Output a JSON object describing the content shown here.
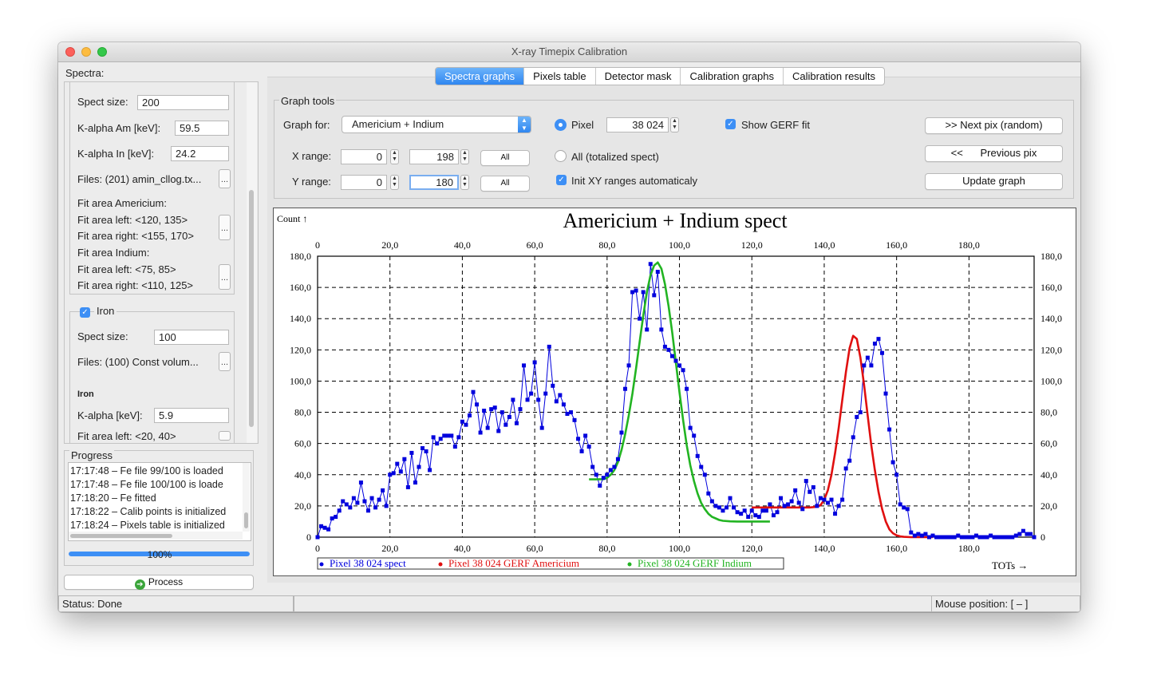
{
  "window": {
    "title": "X-ray Timepix Calibration"
  },
  "tabs": [
    "Spectra graphs",
    "Pixels table",
    "Detector mask",
    "Calibration graphs",
    "Calibration results"
  ],
  "left": {
    "spectra_label": "Spectra:",
    "am_in": {
      "spect_size_label": "Spect size:",
      "spect_size": "200",
      "k_alpha_am_label": "K-alpha Am [keV]:",
      "k_alpha_am": "59.5",
      "k_alpha_in_label": "K-alpha In [keV]:",
      "k_alpha_in": "24.2",
      "files_label": "Files: (201) amin_cllog.tx...",
      "fit_am_title": "Fit area Americium:",
      "fit_am_left": "Fit area left: <120, 135>",
      "fit_am_right": "Fit area right: <155, 170>",
      "fit_in_title": "Fit area Indium:",
      "fit_in_left": "Fit area left: <75, 85>",
      "fit_in_right": "Fit area right: <110, 125>",
      "dots": "..."
    },
    "iron": {
      "title": "Iron",
      "spect_size_label": "Spect size:",
      "spect_size": "100",
      "files_label": "Files: (100) Const volum...",
      "sub_title": "Iron",
      "k_alpha_label": "K-alpha [keV]:",
      "k_alpha": "5.9",
      "fit_left": "Fit area left: <20, 40>",
      "dots": "..."
    },
    "progress": {
      "title": "Progress",
      "log": [
        "17:17:48 – Fe file 99/100 is loaded",
        "17:17:48 – Fe file 100/100 is loade",
        "17:18:20 – Fe fitted",
        "17:18:22 – Calib points is initialized",
        "17:18:24 – Pixels table is initialized"
      ],
      "percent": "100%",
      "value": 1.0
    },
    "process_label": "Process"
  },
  "graph_tools": {
    "title": "Graph tools",
    "graph_for_label": "Graph for:",
    "graph_for_value": "Americium + Indium",
    "pixel_label": "Pixel",
    "pixel_value": "38 024",
    "show_gerf_label": "Show GERF fit",
    "x_range_label": "X range:",
    "x_min": "0",
    "x_max": "198",
    "y_range_label": "Y range:",
    "y_min": "0",
    "y_max": "180",
    "all_label": "All",
    "all_totalized_label": "All (totalized spect)",
    "init_xy_label": "Init XY ranges automaticaly",
    "next_pix_label": ">> Next pix (random)",
    "prev_pix_label": "<<      Previous pix",
    "update_label": "Update graph"
  },
  "status": {
    "left": "Status: Done",
    "right": "Mouse position: [ – ]"
  },
  "chart_data": {
    "type": "scatter",
    "title": "Americium + Indium spect",
    "ylabel": "Count ↑",
    "xlabel": "TOTs →",
    "xlim": [
      0,
      198
    ],
    "ylim": [
      0,
      180
    ],
    "x_ticks": [
      0,
      20,
      40,
      60,
      80,
      100,
      120,
      140,
      160,
      180
    ],
    "x_tick_labels": [
      "0",
      "20,0",
      "40,0",
      "60,0",
      "80,0",
      "100,0",
      "120,0",
      "140,0",
      "160,0",
      "180,0"
    ],
    "y_ticks": [
      0,
      20,
      40,
      60,
      80,
      100,
      120,
      140,
      160,
      180
    ],
    "y_tick_labels": [
      "0",
      "20,0",
      "40,0",
      "60,0",
      "80,0",
      "100,0",
      "120,0",
      "140,0",
      "160,0",
      "180,0"
    ],
    "grid": true,
    "legend_position": "bottom-left",
    "colors": {
      "spect": "#0000dd",
      "americium": "#e01010",
      "indium": "#22b422"
    },
    "series": [
      {
        "name": "Pixel 38 024 spect",
        "x": [
          0,
          1,
          2,
          3,
          4,
          5,
          6,
          7,
          8,
          9,
          10,
          11,
          12,
          13,
          14,
          15,
          16,
          17,
          18,
          19,
          20,
          21,
          22,
          23,
          24,
          25,
          26,
          27,
          28,
          29,
          30,
          31,
          32,
          33,
          34,
          35,
          36,
          37,
          38,
          39,
          40,
          41,
          42,
          43,
          44,
          45,
          46,
          47,
          48,
          49,
          50,
          51,
          52,
          53,
          54,
          55,
          56,
          57,
          58,
          59,
          60,
          61,
          62,
          63,
          64,
          65,
          66,
          67,
          68,
          69,
          70,
          71,
          72,
          73,
          74,
          75,
          76,
          77,
          78,
          79,
          80,
          81,
          82,
          83,
          84,
          85,
          86,
          87,
          88,
          89,
          90,
          91,
          92,
          93,
          94,
          95,
          96,
          97,
          98,
          99,
          100,
          101,
          102,
          103,
          104,
          105,
          106,
          107,
          108,
          109,
          110,
          111,
          112,
          113,
          114,
          115,
          116,
          117,
          118,
          119,
          120,
          121,
          122,
          123,
          124,
          125,
          126,
          127,
          128,
          129,
          130,
          131,
          132,
          133,
          134,
          135,
          136,
          137,
          138,
          139,
          140,
          141,
          142,
          143,
          144,
          145,
          146,
          147,
          148,
          149,
          150,
          151,
          152,
          153,
          154,
          155,
          156,
          157,
          158,
          159,
          160,
          161,
          162,
          163,
          164,
          165,
          166,
          167,
          168,
          169,
          170,
          171,
          172,
          173,
          174,
          175,
          176,
          177,
          178,
          179,
          180,
          181,
          182,
          183,
          184,
          185,
          186,
          187,
          188,
          189,
          190,
          191,
          192,
          193,
          194,
          195,
          196,
          197,
          198
        ],
        "y": [
          0,
          7,
          6,
          5,
          12,
          13,
          17,
          23,
          21,
          19,
          25,
          22,
          35,
          23,
          17,
          25,
          19,
          24,
          30,
          20,
          40,
          41,
          47,
          42,
          50,
          32,
          54,
          35,
          45,
          57,
          55,
          43,
          64,
          60,
          63,
          65,
          65,
          65,
          58,
          64,
          74,
          72,
          78,
          93,
          85,
          67,
          81,
          70,
          82,
          83,
          68,
          80,
          72,
          77,
          88,
          73,
          82,
          110,
          88,
          92,
          112,
          88,
          70,
          92,
          122,
          97,
          87,
          91,
          85,
          79,
          80,
          75,
          63,
          55,
          65,
          58,
          45,
          40,
          33,
          38,
          40,
          43,
          45,
          50,
          67,
          95,
          110,
          157,
          158,
          140,
          157,
          133,
          175,
          155,
          170,
          133,
          122,
          120,
          116,
          113,
          110,
          107,
          95,
          70,
          65,
          52,
          45,
          40,
          28,
          23,
          20,
          19,
          17,
          19,
          25,
          19,
          16,
          15,
          17,
          13,
          17,
          14,
          13,
          17,
          17,
          21,
          14,
          16,
          25,
          20,
          21,
          23,
          30,
          22,
          18,
          36,
          29,
          32,
          20,
          25,
          24,
          22,
          24,
          15,
          20,
          24,
          44,
          49,
          64,
          77,
          80,
          110,
          115,
          110,
          124,
          127,
          118,
          92,
          69,
          48,
          40,
          21,
          19,
          18,
          3,
          1,
          2,
          1,
          2,
          0,
          1,
          0,
          0,
          0,
          0,
          0,
          0,
          1,
          0,
          0,
          0,
          0,
          1,
          0,
          0,
          0,
          1,
          0,
          0,
          0,
          0,
          0,
          0,
          1,
          2,
          4,
          2,
          2,
          0
        ]
      },
      {
        "name": "Pixel 38 024 GERF Americium",
        "x": [
          120,
          122,
          124,
          126,
          128,
          130,
          132,
          134,
          136,
          138,
          139,
          140,
          141,
          142,
          143,
          144,
          145,
          146,
          147,
          148,
          149,
          150,
          151,
          152,
          153,
          154,
          155,
          156,
          157,
          158,
          159,
          160,
          161,
          162,
          164,
          166,
          168,
          170
        ],
        "y": [
          19,
          19,
          19,
          19,
          19,
          19,
          19,
          19,
          19,
          19.5,
          20.5,
          24,
          30,
          40,
          54,
          70,
          88,
          106,
          121,
          129,
          127,
          115,
          98,
          78,
          59,
          43,
          29,
          18,
          10,
          5,
          2.5,
          1.2,
          0.5,
          0.2,
          0,
          0,
          0,
          0
        ]
      },
      {
        "name": "Pixel 38 024 GERF Indium",
        "x": [
          75,
          77,
          79,
          80,
          81,
          82,
          83,
          84,
          85,
          86,
          87,
          88,
          89,
          90,
          91,
          92,
          93,
          94,
          95,
          96,
          97,
          98,
          99,
          100,
          101,
          102,
          103,
          104,
          105,
          106,
          107,
          108,
          109,
          110,
          111,
          112,
          114,
          116,
          118,
          120,
          122,
          124,
          125
        ],
        "y": [
          37,
          37,
          37.2,
          38,
          40,
          43,
          48,
          56,
          66,
          78,
          92,
          108,
          125,
          142,
          157,
          168,
          174,
          176,
          172,
          162,
          148,
          131,
          112,
          93,
          75,
          59,
          46,
          36,
          28,
          22,
          18,
          15,
          13,
          12,
          11,
          10.5,
          10.1,
          10,
          10,
          10,
          10,
          10,
          10
        ]
      }
    ]
  }
}
